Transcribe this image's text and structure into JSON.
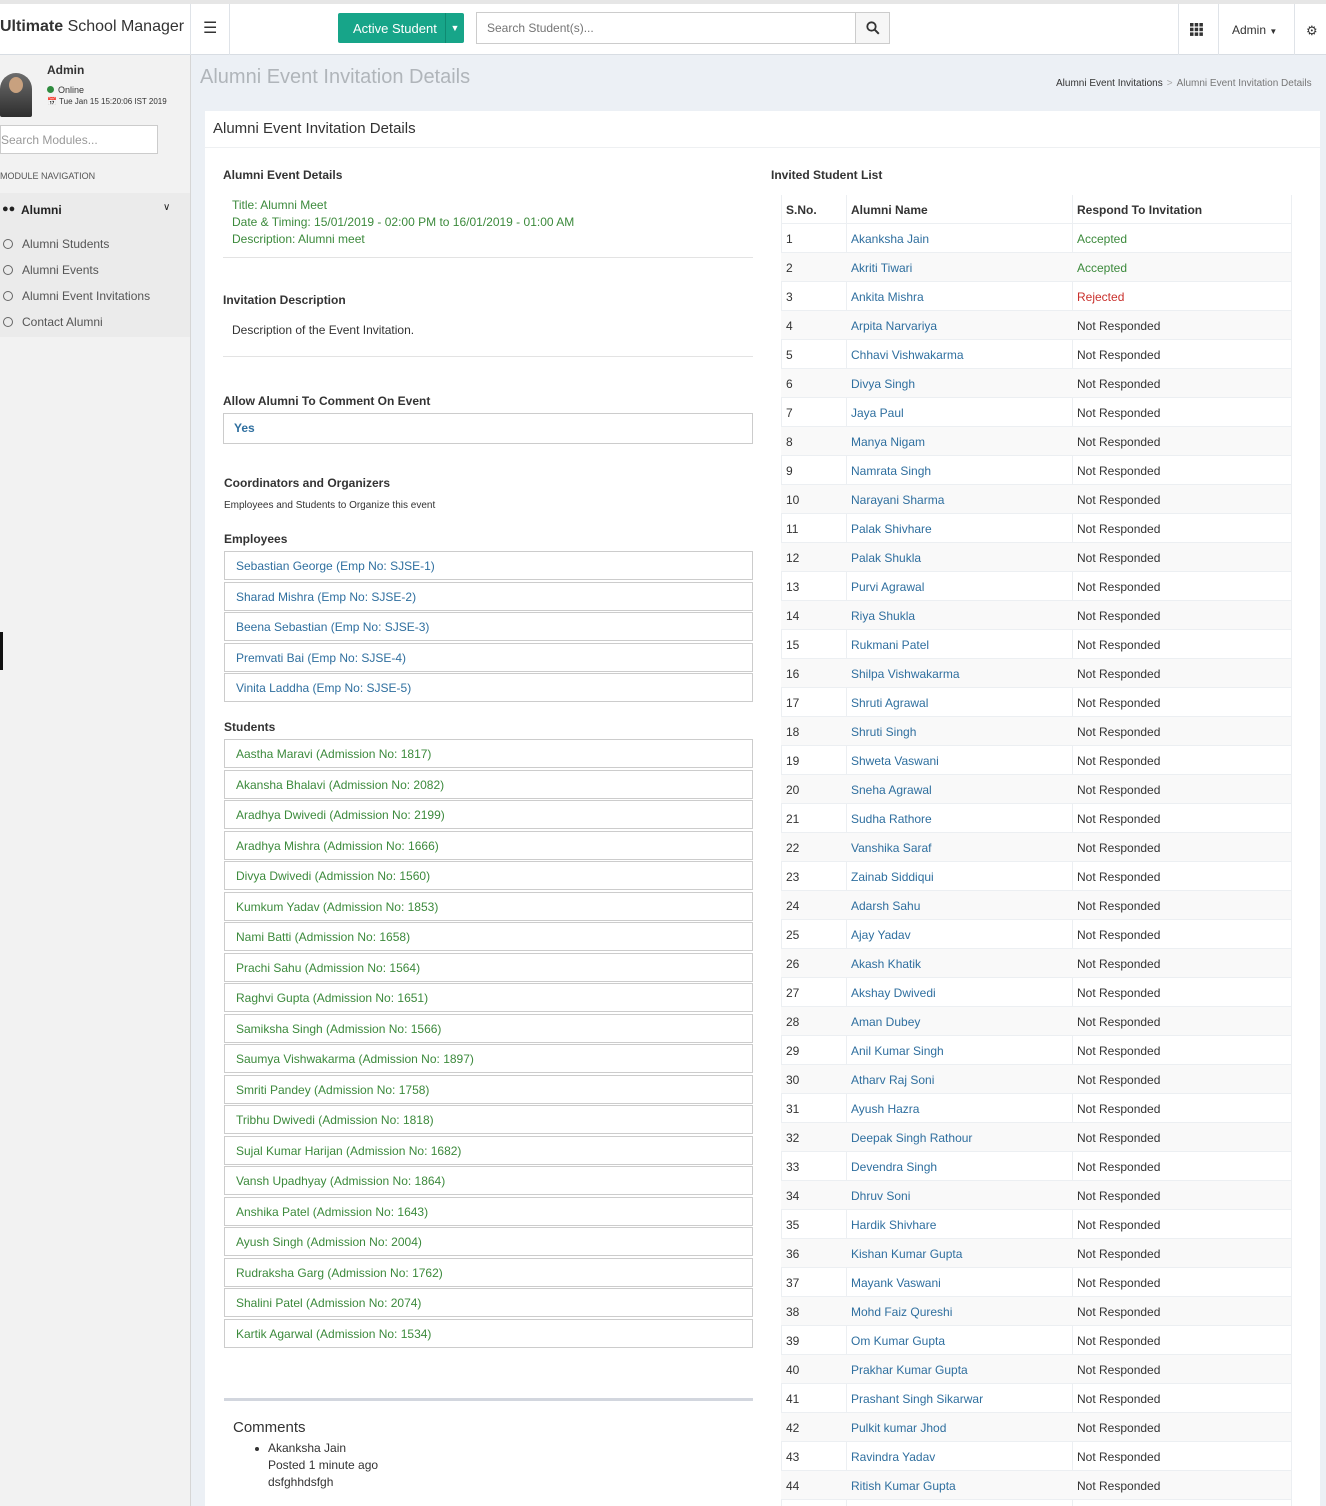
{
  "brand": {
    "bold": "Ultimate",
    "rest": " School Manager"
  },
  "topbar": {
    "student_filter": "Active Student",
    "search_placeholder": "Search Student(s)...",
    "user_menu": "Admin"
  },
  "sidebar": {
    "user_name": "Admin",
    "status": "Online",
    "datetime": "Tue Jan 15 15:20:06 IST 2019",
    "search_placeholder": "Search Modules...",
    "nav_heading": "MODULE NAVIGATION",
    "group": "Alumni",
    "items": [
      "Alumni Students",
      "Alumni Events",
      "Alumni Event Invitations",
      "Contact Alumni"
    ]
  },
  "header": {
    "title": "Alumni Event Invitation Details",
    "breadcrumb": [
      "Alumni Event Invitations",
      "Alumni Event Invitation Details"
    ]
  },
  "box_title": "Alumni Event Invitation Details",
  "event": {
    "heading": "Alumni Event Details",
    "title": "Title: Alumni Meet",
    "timing": "Date & Timing: 15/01/2019 - 02:00 PM to 16/01/2019 - 01:00 AM",
    "description": "Description: Alumni meet"
  },
  "invitation": {
    "heading": "Invitation Description",
    "text": "Description of the Event Invitation."
  },
  "allow_comment": {
    "heading": "Allow Alumni To Comment On Event",
    "value": "Yes"
  },
  "coordinators": {
    "heading": "Coordinators and Organizers",
    "note": "Employees and Students to Organize this event",
    "employees_heading": "Employees",
    "employees": [
      "Sebastian George (Emp No: SJSE-1)",
      "Sharad Mishra (Emp No: SJSE-2)",
      "Beena Sebastian (Emp No: SJSE-3)",
      "Premvati Bai (Emp No: SJSE-4)",
      "Vinita Laddha (Emp No: SJSE-5)"
    ],
    "students_heading": "Students",
    "students": [
      "Aastha Maravi (Admission No: 1817)",
      "Akansha Bhalavi (Admission No: 2082)",
      "Aradhya Dwivedi (Admission No: 2199)",
      "Aradhya Mishra (Admission No: 1666)",
      "Divya Dwivedi (Admission No: 1560)",
      "Kumkum Yadav (Admission No: 1853)",
      "Nami Batti (Admission No: 1658)",
      "Prachi Sahu (Admission No: 1564)",
      "Raghvi Gupta (Admission No: 1651)",
      "Samiksha Singh (Admission No: 1566)",
      "Saumya Vishwakarma (Admission No: 1897)",
      "Smriti Pandey (Admission No: 1758)",
      "Tribhu Dwivedi (Admission No: 1818)",
      "Sujal Kumar Harijan (Admission No: 1682)",
      "Vansh Upadhyay (Admission No: 1864)",
      "Anshika Patel (Admission No: 1643)",
      "Ayush Singh (Admission No: 2004)",
      "Rudraksha Garg (Admission No: 1762)",
      "Shalini Patel (Admission No: 2074)",
      "Kartik Agarwal (Admission No: 1534)"
    ]
  },
  "comments": {
    "heading": "Comments",
    "author": "Akanksha Jain",
    "posted": "Posted 1 minute ago",
    "text": "dsfghhdsfgh"
  },
  "invited": {
    "heading": "Invited Student List",
    "columns": [
      "S.No.",
      "Alumni Name",
      "Respond To Invitation"
    ],
    "rows": [
      [
        "1",
        "Akanksha Jain",
        "Accepted"
      ],
      [
        "2",
        "Akriti Tiwari",
        "Accepted"
      ],
      [
        "3",
        "Ankita Mishra",
        "Rejected"
      ],
      [
        "4",
        "Arpita Narvariya",
        "Not Responded"
      ],
      [
        "5",
        "Chhavi Vishwakarma",
        "Not Responded"
      ],
      [
        "6",
        "Divya Singh",
        "Not Responded"
      ],
      [
        "7",
        "Jaya Paul",
        "Not Responded"
      ],
      [
        "8",
        "Manya Nigam",
        "Not Responded"
      ],
      [
        "9",
        "Namrata Singh",
        "Not Responded"
      ],
      [
        "10",
        "Narayani Sharma",
        "Not Responded"
      ],
      [
        "11",
        "Palak Shivhare",
        "Not Responded"
      ],
      [
        "12",
        "Palak Shukla",
        "Not Responded"
      ],
      [
        "13",
        "Purvi Agrawal",
        "Not Responded"
      ],
      [
        "14",
        "Riya Shukla",
        "Not Responded"
      ],
      [
        "15",
        "Rukmani Patel",
        "Not Responded"
      ],
      [
        "16",
        "Shilpa Vishwakarma",
        "Not Responded"
      ],
      [
        "17",
        "Shruti Agrawal",
        "Not Responded"
      ],
      [
        "18",
        "Shruti Singh",
        "Not Responded"
      ],
      [
        "19",
        "Shweta Vaswani",
        "Not Responded"
      ],
      [
        "20",
        "Sneha Agrawal",
        "Not Responded"
      ],
      [
        "21",
        "Sudha Rathore",
        "Not Responded"
      ],
      [
        "22",
        "Vanshika Saraf",
        "Not Responded"
      ],
      [
        "23",
        "Zainab Siddiqui",
        "Not Responded"
      ],
      [
        "24",
        "Adarsh Sahu",
        "Not Responded"
      ],
      [
        "25",
        "Ajay Yadav",
        "Not Responded"
      ],
      [
        "26",
        "Akash Khatik",
        "Not Responded"
      ],
      [
        "27",
        "Akshay Dwivedi",
        "Not Responded"
      ],
      [
        "28",
        "Aman Dubey",
        "Not Responded"
      ],
      [
        "29",
        "Anil Kumar Singh",
        "Not Responded"
      ],
      [
        "30",
        "Atharv Raj Soni",
        "Not Responded"
      ],
      [
        "31",
        "Ayush Hazra",
        "Not Responded"
      ],
      [
        "32",
        "Deepak Singh Rathour",
        "Not Responded"
      ],
      [
        "33",
        "Devendra Singh",
        "Not Responded"
      ],
      [
        "34",
        "Dhruv Soni",
        "Not Responded"
      ],
      [
        "35",
        "Hardik Shivhare",
        "Not Responded"
      ],
      [
        "36",
        "Kishan Kumar Gupta",
        "Not Responded"
      ],
      [
        "37",
        "Mayank Vaswani",
        "Not Responded"
      ],
      [
        "38",
        "Mohd Faiz Qureshi",
        "Not Responded"
      ],
      [
        "39",
        "Om Kumar Gupta",
        "Not Responded"
      ],
      [
        "40",
        "Prakhar Kumar Gupta",
        "Not Responded"
      ],
      [
        "41",
        "Prashant Singh Sikarwar",
        "Not Responded"
      ],
      [
        "42",
        "Pulkit kumar Jhod",
        "Not Responded"
      ],
      [
        "43",
        "Ravindra Yadav",
        "Not Responded"
      ],
      [
        "44",
        "Ritish Kumar Gupta",
        "Not Responded"
      ]
    ]
  }
}
